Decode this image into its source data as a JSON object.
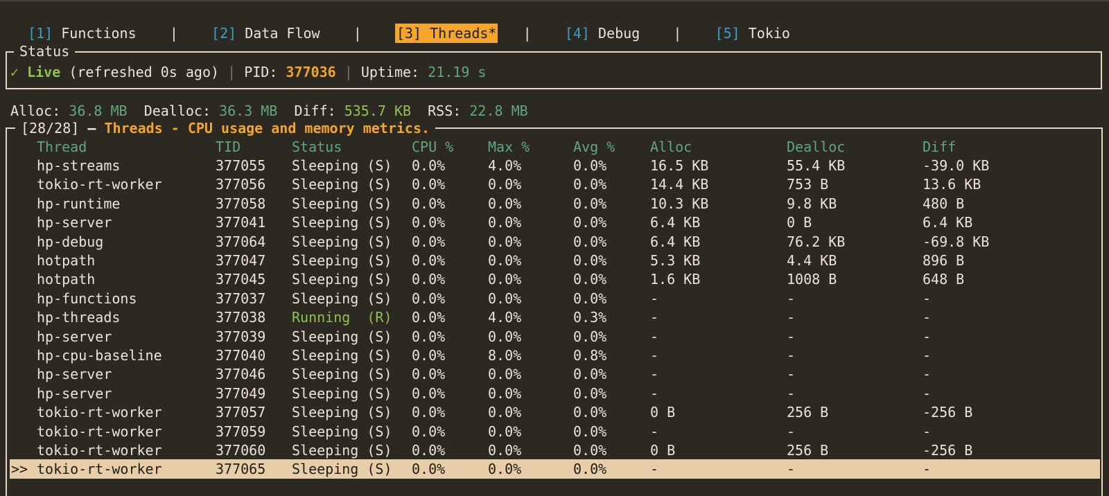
{
  "tabs": [
    {
      "num": "[1]",
      "label": "Functions",
      "active": false
    },
    {
      "num": "[2]",
      "label": "Data Flow",
      "active": false
    },
    {
      "num": "[3]",
      "label": "Threads*",
      "active": true
    },
    {
      "num": "[4]",
      "label": "Debug",
      "active": false
    },
    {
      "num": "[5]",
      "label": "Tokio",
      "active": false
    }
  ],
  "tab_separator": "|",
  "status": {
    "title": "Status",
    "check": "✓",
    "live": "Live",
    "refreshed": "(refreshed 0s ago)",
    "separator": "|",
    "pid_label": "PID:",
    "pid_value": "377036",
    "uptime_label": "Uptime:",
    "uptime_value": "21.19 s"
  },
  "memory": {
    "alloc_label": "Alloc:",
    "alloc_value": "36.8 MB",
    "dealloc_label": "Dealloc:",
    "dealloc_value": "36.3 MB",
    "diff_label": "Diff:",
    "diff_value": "535.7 KB",
    "rss_label": "RSS:",
    "rss_value": "22.8 MB"
  },
  "threads_panel": {
    "count": "[28/28]",
    "dash": "—",
    "title": "Threads - CPU usage and memory metrics.",
    "selection_marker": ">>",
    "columns": [
      "Thread",
      "TID",
      "Status",
      "CPU %",
      "Max %",
      "Avg %",
      "Alloc",
      "Dealloc",
      "Diff"
    ],
    "rows": [
      {
        "thread": "hp-streams",
        "tid": "377055",
        "status": "Sleeping (S)",
        "cpu": "0.0%",
        "max": "4.0%",
        "avg": "0.0%",
        "alloc": "16.5 KB",
        "dealloc": "55.4 KB",
        "diff": "-39.0 KB",
        "selected": false
      },
      {
        "thread": "tokio-rt-worker",
        "tid": "377056",
        "status": "Sleeping (S)",
        "cpu": "0.0%",
        "max": "0.0%",
        "avg": "0.0%",
        "alloc": "14.4 KB",
        "dealloc": "753 B",
        "diff": "13.6 KB",
        "selected": false
      },
      {
        "thread": "hp-runtime",
        "tid": "377058",
        "status": "Sleeping (S)",
        "cpu": "0.0%",
        "max": "0.0%",
        "avg": "0.0%",
        "alloc": "10.3 KB",
        "dealloc": "9.8 KB",
        "diff": "480 B",
        "selected": false
      },
      {
        "thread": "hp-server",
        "tid": "377041",
        "status": "Sleeping (S)",
        "cpu": "0.0%",
        "max": "0.0%",
        "avg": "0.0%",
        "alloc": "6.4 KB",
        "dealloc": "0 B",
        "diff": "6.4 KB",
        "selected": false
      },
      {
        "thread": "hp-debug",
        "tid": "377064",
        "status": "Sleeping (S)",
        "cpu": "0.0%",
        "max": "0.0%",
        "avg": "0.0%",
        "alloc": "6.4 KB",
        "dealloc": "76.2 KB",
        "diff": "-69.8 KB",
        "selected": false
      },
      {
        "thread": "hotpath",
        "tid": "377047",
        "status": "Sleeping (S)",
        "cpu": "0.0%",
        "max": "0.0%",
        "avg": "0.0%",
        "alloc": "5.3 KB",
        "dealloc": "4.4 KB",
        "diff": "896 B",
        "selected": false
      },
      {
        "thread": "hotpath",
        "tid": "377045",
        "status": "Sleeping (S)",
        "cpu": "0.0%",
        "max": "0.0%",
        "avg": "0.0%",
        "alloc": "1.6 KB",
        "dealloc": "1008 B",
        "diff": "648 B",
        "selected": false
      },
      {
        "thread": "hp-functions",
        "tid": "377037",
        "status": "Sleeping (S)",
        "cpu": "0.0%",
        "max": "0.0%",
        "avg": "0.0%",
        "alloc": "-",
        "dealloc": "-",
        "diff": "-",
        "selected": false
      },
      {
        "thread": "hp-threads",
        "tid": "377038",
        "status": "Running  (R)",
        "cpu": "0.0%",
        "max": "4.0%",
        "avg": "0.3%",
        "alloc": "-",
        "dealloc": "-",
        "diff": "-",
        "selected": false
      },
      {
        "thread": "hp-server",
        "tid": "377039",
        "status": "Sleeping (S)",
        "cpu": "0.0%",
        "max": "0.0%",
        "avg": "0.0%",
        "alloc": "-",
        "dealloc": "-",
        "diff": "-",
        "selected": false
      },
      {
        "thread": "hp-cpu-baseline",
        "tid": "377040",
        "status": "Sleeping (S)",
        "cpu": "0.0%",
        "max": "8.0%",
        "avg": "0.8%",
        "alloc": "-",
        "dealloc": "-",
        "diff": "-",
        "selected": false
      },
      {
        "thread": "hp-server",
        "tid": "377046",
        "status": "Sleeping (S)",
        "cpu": "0.0%",
        "max": "0.0%",
        "avg": "0.0%",
        "alloc": "-",
        "dealloc": "-",
        "diff": "-",
        "selected": false
      },
      {
        "thread": "hp-server",
        "tid": "377049",
        "status": "Sleeping (S)",
        "cpu": "0.0%",
        "max": "0.0%",
        "avg": "0.0%",
        "alloc": "-",
        "dealloc": "-",
        "diff": "-",
        "selected": false
      },
      {
        "thread": "tokio-rt-worker",
        "tid": "377057",
        "status": "Sleeping (S)",
        "cpu": "0.0%",
        "max": "0.0%",
        "avg": "0.0%",
        "alloc": "0 B",
        "dealloc": "256 B",
        "diff": "-256 B",
        "selected": false
      },
      {
        "thread": "tokio-rt-worker",
        "tid": "377059",
        "status": "Sleeping (S)",
        "cpu": "0.0%",
        "max": "0.0%",
        "avg": "0.0%",
        "alloc": "-",
        "dealloc": "-",
        "diff": "-",
        "selected": false
      },
      {
        "thread": "tokio-rt-worker",
        "tid": "377060",
        "status": "Sleeping (S)",
        "cpu": "0.0%",
        "max": "0.0%",
        "avg": "0.0%",
        "alloc": "0 B",
        "dealloc": "256 B",
        "diff": "-256 B",
        "selected": false
      },
      {
        "thread": "tokio-rt-worker",
        "tid": "377065",
        "status": "Sleeping (S)",
        "cpu": "0.0%",
        "max": "0.0%",
        "avg": "0.0%",
        "alloc": "-",
        "dealloc": "-",
        "diff": "-",
        "selected": true
      }
    ]
  },
  "colors": {
    "background": "#2b2921",
    "foreground": "#ece4d6",
    "accent_orange": "#f4a52c",
    "tab_number_blue": "#3aa0c8",
    "header_green": "#62a77a",
    "live_green": "#8fc24f",
    "selected_row_bg": "#e8cda9"
  }
}
